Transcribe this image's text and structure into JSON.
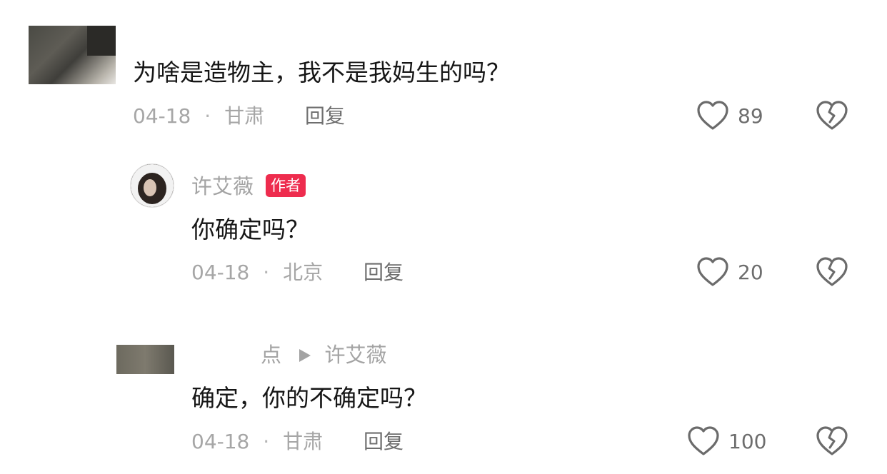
{
  "comments": [
    {
      "text": "为啥是造物主，我不是我妈生的吗？",
      "date": "04-18",
      "separator": "·",
      "location": "甘肃",
      "reply_label": "回复",
      "likes": "89"
    },
    {
      "username": "许艾薇",
      "badge": "作者",
      "text": "你确定吗？",
      "date": "04-18",
      "separator": "·",
      "location": "北京",
      "reply_label": "回复",
      "likes": "20"
    },
    {
      "username_part": "点",
      "reply_to": "许艾薇",
      "text": "确定，你的不确定吗？",
      "date": "04-18",
      "separator": "·",
      "location": "甘肃",
      "reply_label": "回复",
      "likes": "100"
    }
  ],
  "icons": {
    "like": "heart-outline-icon",
    "dislike": "broken-heart-icon",
    "reply_arrow": "play-triangle-icon"
  },
  "colors": {
    "author_badge": "#ee2c4e",
    "text_primary": "#161616",
    "text_meta": "#a6a6a6"
  }
}
